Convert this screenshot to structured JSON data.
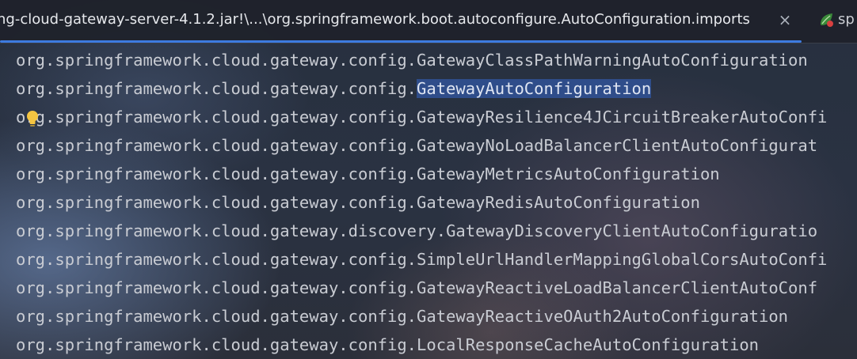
{
  "tabs": {
    "active": {
      "title": "ng-cloud-gateway-server-4.1.2.jar!\\...\\org.springframework.boot.autoconfigure.AutoConfiguration.imports",
      "close_icon": "close-icon",
      "close_glyph": "×"
    },
    "next": {
      "label": "sp",
      "icon": "spring-icon"
    }
  },
  "editor": {
    "lines": [
      {
        "prefix": "org.springframework.cloud.gateway.config.",
        "rest": "GatewayClassPathWarningAutoConfiguration"
      },
      {
        "prefix": "org.springframework.cloud.gateway.config.",
        "selected": "GatewayAutoConfiguration",
        "rest": ""
      },
      {
        "prefix": "org.springframework.cloud.gateway.config.",
        "rest": "GatewayResilience4JCircuitBreakerAutoConfi"
      },
      {
        "prefix": "org.springframework.cloud.gateway.config.",
        "rest": "GatewayNoLoadBalancerClientAutoConfigurat"
      },
      {
        "prefix": "org.springframework.cloud.gateway.config.",
        "rest": "GatewayMetricsAutoConfiguration"
      },
      {
        "prefix": "org.springframework.cloud.gateway.config.",
        "rest": "GatewayRedisAutoConfiguration"
      },
      {
        "prefix": "org.springframework.cloud.gateway.discovery.",
        "rest": "GatewayDiscoveryClientAutoConfiguratio"
      },
      {
        "prefix": "org.springframework.cloud.gateway.config.",
        "rest": "SimpleUrlHandlerMappingGlobalCorsAutoConfi"
      },
      {
        "prefix": "org.springframework.cloud.gateway.config.",
        "rest": "GatewayReactiveLoadBalancerClientAutoConf"
      },
      {
        "prefix": "org.springframework.cloud.gateway.config.",
        "rest": "GatewayReactiveOAuth2AutoConfiguration"
      },
      {
        "prefix": "org.springframework.cloud.gateway.config.",
        "rest": "LocalResponseCacheAutoConfiguration"
      }
    ],
    "intention_icon": "lightbulb-icon"
  },
  "colors": {
    "tab_underline": "#3d7be0",
    "selection": "#2f4d8a",
    "text": "#c9ccd3",
    "bulb": "#f5c542"
  }
}
